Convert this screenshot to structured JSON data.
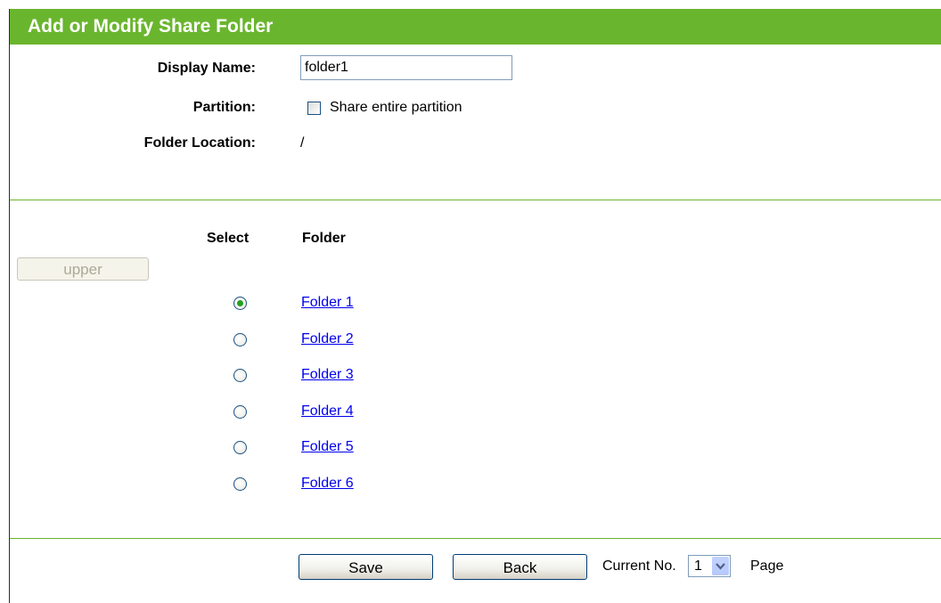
{
  "header": {
    "title": "Add or Modify Share Folder"
  },
  "form": {
    "display_name_label": "Display Name:",
    "display_name_value": "folder1",
    "partition_label": "Partition:",
    "share_entire_partition_label": "Share entire partition",
    "share_entire_partition_checked": false,
    "folder_location_label": "Folder Location:",
    "folder_location_value": "/"
  },
  "folder_table": {
    "select_header": "Select",
    "folder_header": "Folder",
    "upper_button_label": "upper",
    "rows": [
      {
        "label": "Folder 1",
        "selected": true
      },
      {
        "label": "Folder 2",
        "selected": false
      },
      {
        "label": "Folder 3",
        "selected": false
      },
      {
        "label": "Folder 4",
        "selected": false
      },
      {
        "label": "Folder 5",
        "selected": false
      },
      {
        "label": "Folder 6",
        "selected": false
      }
    ]
  },
  "footer": {
    "save_label": "Save",
    "back_label": "Back",
    "current_no_label": "Current No.",
    "current_page": "1",
    "page_label": "Page"
  },
  "colors": {
    "accent": "#6ab52e",
    "link": "#0000ee"
  }
}
